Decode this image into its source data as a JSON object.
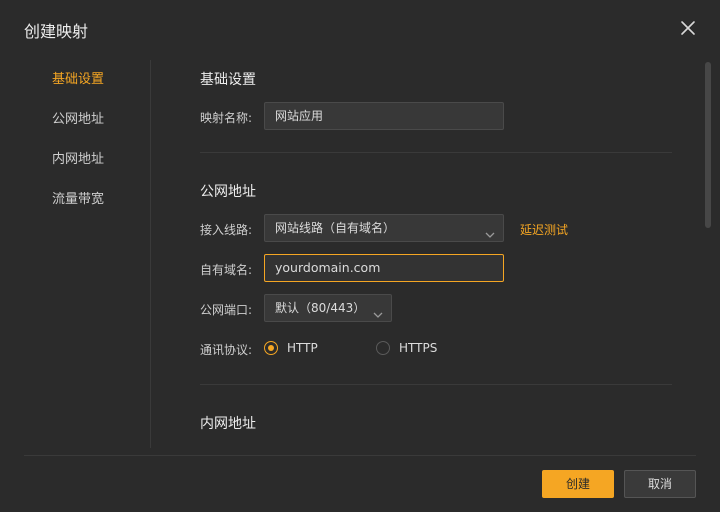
{
  "dialog": {
    "title": "创建映射",
    "close_icon": "close-icon"
  },
  "sidebar": {
    "items": [
      {
        "label": "基础设置",
        "active": true
      },
      {
        "label": "公网地址",
        "active": false
      },
      {
        "label": "内网地址",
        "active": false
      },
      {
        "label": "流量带宽",
        "active": false
      }
    ]
  },
  "basic": {
    "section_title": "基础设置",
    "name_label": "映射名称:",
    "name_value": "网站应用"
  },
  "public": {
    "section_title": "公网地址",
    "line_label": "接入线路:",
    "line_value": "网站线路（自有域名）",
    "latency_link": "延迟测试",
    "domain_label": "自有域名:",
    "domain_value": "yourdomain.com",
    "port_label": "公网端口:",
    "port_value": "默认（80/443）",
    "protocol_label": "通讯协议:",
    "protocol_options": [
      {
        "label": "HTTP",
        "selected": true
      },
      {
        "label": "HTTPS",
        "selected": false
      }
    ]
  },
  "internal": {
    "section_title": "内网地址"
  },
  "footer": {
    "create_label": "创建",
    "cancel_label": "取消"
  },
  "colors": {
    "accent": "#f5a623",
    "background": "#2b2b2b"
  }
}
